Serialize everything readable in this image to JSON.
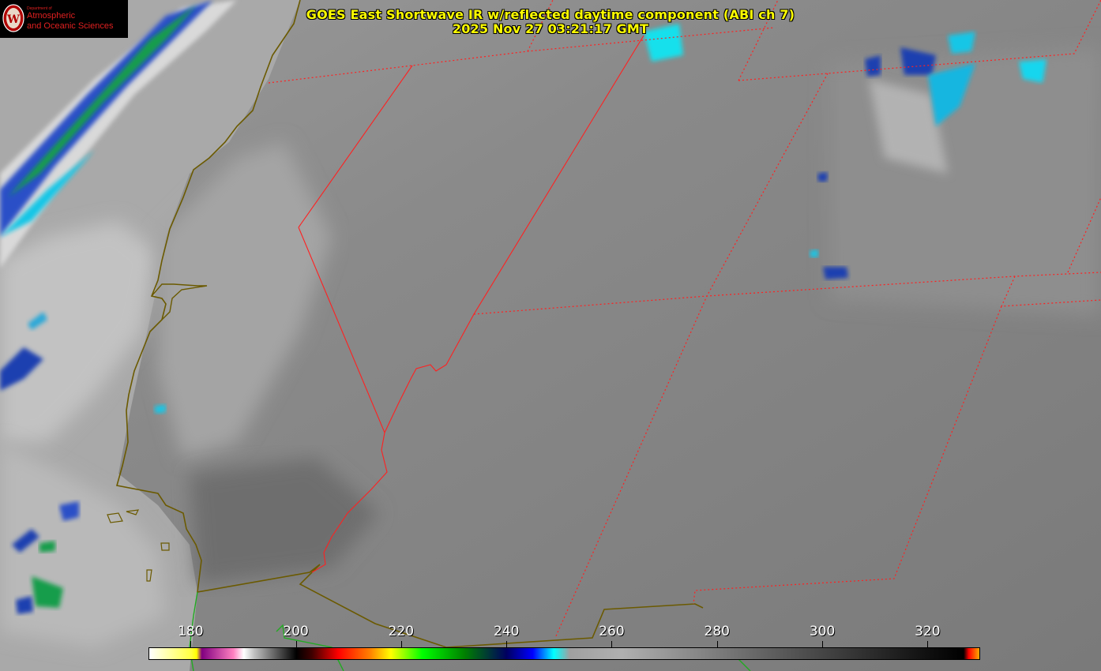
{
  "title": {
    "line1": "GOES East Shortwave IR w/reflected daytime component (ABI ch 7)",
    "line2": "2025 Nov 27 03:21:17 GMT"
  },
  "logo": {
    "dept": "Department of",
    "line1": "Atmospheric",
    "line2": "and Oceanic Sciences",
    "seal_letter": "W"
  },
  "colorbar": {
    "min": 172,
    "max": 330,
    "tick_labels": [
      "180",
      "200",
      "220",
      "240",
      "260",
      "280",
      "300",
      "320"
    ],
    "ticks": [
      180,
      200,
      220,
      240,
      260,
      280,
      300,
      320
    ],
    "stops": [
      {
        "value": 172,
        "color": "#ffffff"
      },
      {
        "value": 180,
        "color": "#ffff40"
      },
      {
        "value": 181,
        "color": "#ffff00"
      },
      {
        "value": 182,
        "color": "#800080"
      },
      {
        "value": 188,
        "color": "#ff80c0"
      },
      {
        "value": 190,
        "color": "#ffffff"
      },
      {
        "value": 192,
        "color": "#c0c0c0"
      },
      {
        "value": 200,
        "color": "#000000"
      },
      {
        "value": 203,
        "color": "#400000"
      },
      {
        "value": 208,
        "color": "#ff0000"
      },
      {
        "value": 214,
        "color": "#ff8000"
      },
      {
        "value": 218,
        "color": "#ffff00"
      },
      {
        "value": 224,
        "color": "#00ff00"
      },
      {
        "value": 232,
        "color": "#008000"
      },
      {
        "value": 240,
        "color": "#000060"
      },
      {
        "value": 245,
        "color": "#0000ff"
      },
      {
        "value": 249,
        "color": "#00ffff"
      },
      {
        "value": 252,
        "color": "#a0a0a0"
      },
      {
        "value": 262,
        "color": "#b0b0b0"
      },
      {
        "value": 290,
        "color": "#606060"
      },
      {
        "value": 320,
        "color": "#101010"
      },
      {
        "value": 327,
        "color": "#000000"
      },
      {
        "value": 328,
        "color": "#ff0000"
      },
      {
        "value": 330,
        "color": "#ffaa00"
      }
    ]
  },
  "colors": {
    "state_border": "#ff2020",
    "country_border": "#6b5a00",
    "coast": "#22aa22",
    "title": "#ffff00"
  }
}
